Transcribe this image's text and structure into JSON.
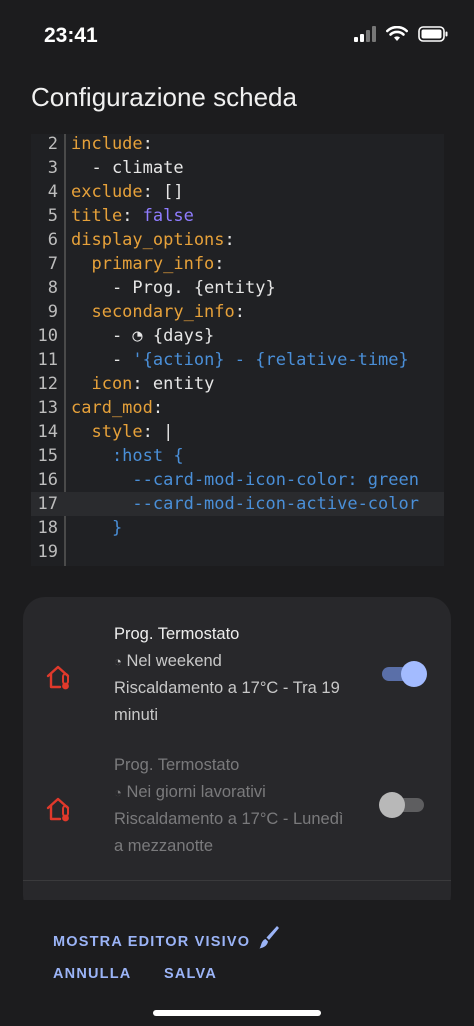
{
  "status": {
    "time": "23:41"
  },
  "header": {
    "title": "Configurazione scheda"
  },
  "editor": {
    "lines": [
      {
        "n": "2",
        "tokens": [
          {
            "t": "include",
            "c": "k"
          },
          {
            "t": ":",
            "c": "v"
          }
        ]
      },
      {
        "n": "3",
        "tokens": [
          {
            "t": "  - climate",
            "c": "v"
          }
        ]
      },
      {
        "n": "4",
        "tokens": [
          {
            "t": "exclude",
            "c": "k"
          },
          {
            "t": ": []",
            "c": "v"
          }
        ]
      },
      {
        "n": "5",
        "tokens": [
          {
            "t": "title",
            "c": "k"
          },
          {
            "t": ": ",
            "c": "v"
          },
          {
            "t": "false",
            "c": "b"
          }
        ]
      },
      {
        "n": "6",
        "tokens": [
          {
            "t": "display_options",
            "c": "k"
          },
          {
            "t": ":",
            "c": "v"
          }
        ]
      },
      {
        "n": "7",
        "tokens": [
          {
            "t": "  primary_info",
            "c": "k"
          },
          {
            "t": ":",
            "c": "v"
          }
        ]
      },
      {
        "n": "8",
        "tokens": [
          {
            "t": "    - Prog. {entity}",
            "c": "v"
          }
        ]
      },
      {
        "n": "9",
        "tokens": [
          {
            "t": "  secondary_info",
            "c": "k"
          },
          {
            "t": ":",
            "c": "v"
          }
        ]
      },
      {
        "n": "10",
        "tokens": [
          {
            "t": "    - ◔ {days}",
            "c": "v"
          }
        ]
      },
      {
        "n": "11",
        "tokens": [
          {
            "t": "    - ",
            "c": "v"
          },
          {
            "t": "'{action} - {relative-time}",
            "c": "s"
          }
        ]
      },
      {
        "n": "12",
        "tokens": [
          {
            "t": "  icon",
            "c": "k"
          },
          {
            "t": ": entity",
            "c": "v"
          }
        ]
      },
      {
        "n": "13",
        "tokens": [
          {
            "t": "card_mod",
            "c": "k"
          },
          {
            "t": ":",
            "c": "v"
          }
        ]
      },
      {
        "n": "14",
        "tokens": [
          {
            "t": "  style",
            "c": "k"
          },
          {
            "t": ": |",
            "c": "v"
          }
        ]
      },
      {
        "n": "15",
        "tokens": [
          {
            "t": "    :host {",
            "c": "s"
          }
        ]
      },
      {
        "n": "16",
        "tokens": [
          {
            "t": "      --card-mod-icon-color: green",
            "c": "s"
          }
        ]
      },
      {
        "n": "17",
        "tokens": [
          {
            "t": "      --card-mod-icon-active-color",
            "c": "s"
          }
        ],
        "active": true
      },
      {
        "n": "18",
        "tokens": [
          {
            "t": "    }",
            "c": "s"
          }
        ]
      },
      {
        "n": "19",
        "tokens": []
      }
    ]
  },
  "preview": {
    "rows": [
      {
        "primary": "Prog. Termostato",
        "days_icon": "◔",
        "days": "Nel weekend",
        "secondary_line1": "Riscaldamento a 17°C - Tra 19",
        "secondary_line2": "minuti",
        "icon": "home-thermometer-icon",
        "on": true
      },
      {
        "primary": "Prog. Termostato",
        "days_icon": "◔",
        "days": "Nei giorni lavorativi",
        "secondary_line1": "Riscaldamento a 17°C - Lunedì",
        "secondary_line2": "a mezzanotte",
        "icon": "home-thermometer-icon",
        "on": false
      }
    ]
  },
  "actions": {
    "show_visual_editor": "MOSTRA EDITOR VISIVO",
    "cancel": "ANNULLA",
    "save": "SALVA"
  },
  "colors": {
    "background": "#1c1c1e",
    "accent": "#9bb4f7",
    "icon_red": "#e0392b",
    "yaml_key": "#e6a13a",
    "yaml_bool": "#8f7cff",
    "yaml_string": "#4a8fd8"
  }
}
